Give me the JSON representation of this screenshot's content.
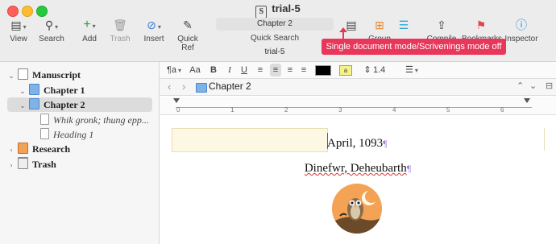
{
  "window": {
    "title": "trial-5",
    "subtitle": "trial-5"
  },
  "toolbar": {
    "view": "View",
    "search": "Search",
    "add": "Add",
    "trash": "Trash",
    "insert": "Insert",
    "quick_ref": "Quick Ref",
    "quick_search_field": "Chapter 2",
    "quick_search_label": "Quick Search",
    "group_mode": "Group Mode",
    "compile": "Compile",
    "bookmarks": "Bookmarks",
    "inspector": "Inspector"
  },
  "tooltip": "Single document mode/Scrivenings mode off",
  "binder": {
    "items": [
      {
        "label": "Manuscript",
        "icon": "manuscript-icon",
        "level": 0,
        "expanded": true,
        "bold": true
      },
      {
        "label": "Chapter 1",
        "icon": "folder-icon",
        "level": 1,
        "expanded": true,
        "bold": true
      },
      {
        "label": "Chapter 2",
        "icon": "folder-icon",
        "level": 1,
        "expanded": true,
        "bold": true,
        "selected": true
      },
      {
        "label": "Whik gronk; thung epp...",
        "icon": "page-icon",
        "level": 2,
        "italic": true
      },
      {
        "label": "Heading 1",
        "icon": "page-icon",
        "level": 2,
        "italic": true
      },
      {
        "label": "Research",
        "icon": "research-folder-icon",
        "level": 0,
        "expanded": false,
        "bold": true
      },
      {
        "label": "Trash",
        "icon": "trash-icon",
        "level": 0,
        "expanded": false,
        "bold": true
      }
    ]
  },
  "format_bar": {
    "paragraph": "¶a",
    "font": "Aa",
    "bold": "B",
    "italic": "I",
    "underline": "U",
    "line_spacing": "1.4",
    "highlight_label": "a",
    "text_color": "#000000",
    "highlight_color": "#f6f28a"
  },
  "path_bar": {
    "title": "Chapter 2"
  },
  "ruler": {
    "marks": [
      "0",
      "1",
      "2",
      "3",
      "4",
      "5",
      "6"
    ]
  },
  "document": {
    "line1": "April, 1093",
    "line2": "Dinefwr, Deheubarth",
    "pilcrow": "¶"
  },
  "colors": {
    "accent": "#e8375a",
    "selection": "#dcdcdc",
    "folder": "#7fb2e5"
  }
}
